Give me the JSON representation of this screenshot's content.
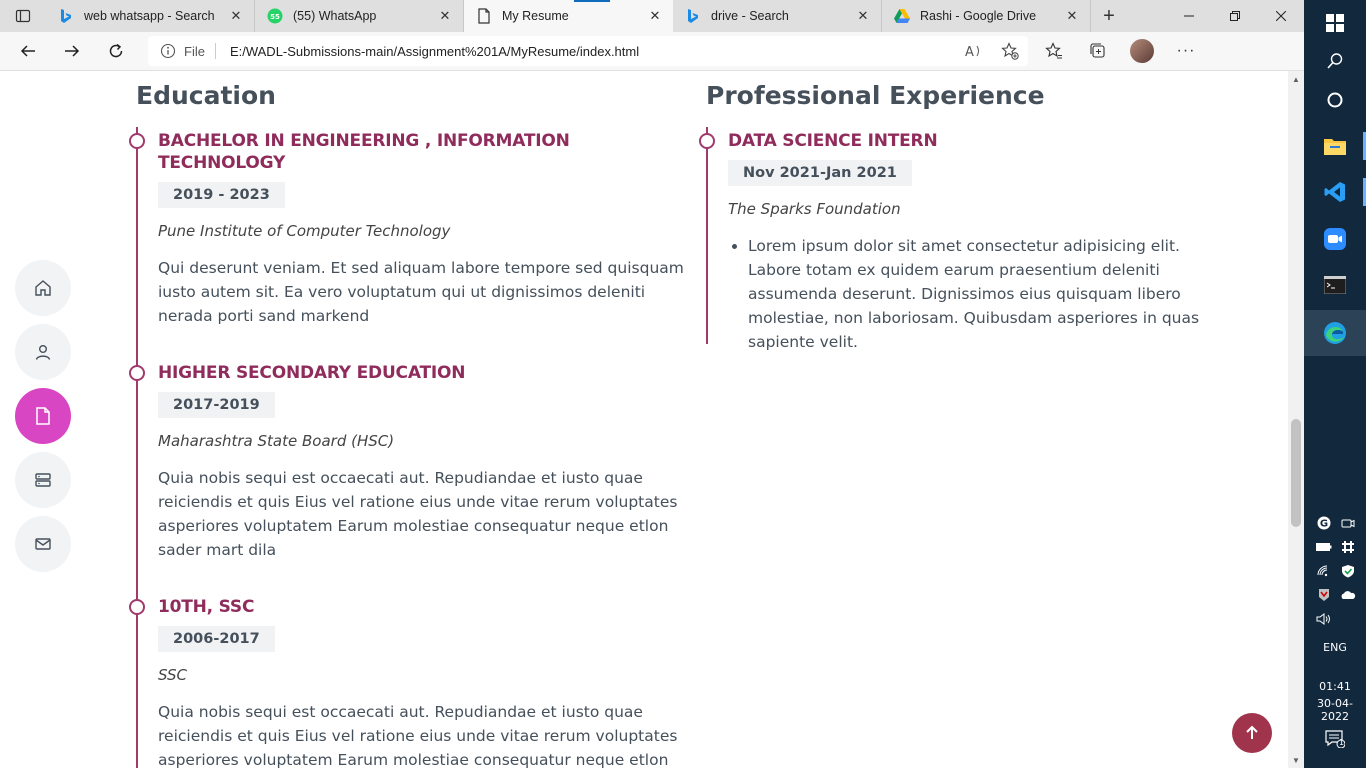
{
  "browser": {
    "tabs": [
      {
        "title": "web whatsapp - Search",
        "icon": "bing-icon",
        "active": false
      },
      {
        "title": "(55) WhatsApp",
        "icon": "whatsapp-icon",
        "active": false
      },
      {
        "title": "My Resume",
        "icon": "document-icon",
        "active": true
      },
      {
        "title": "drive - Search",
        "icon": "bing-icon",
        "active": false
      },
      {
        "title": "Rashi - Google Drive",
        "icon": "google-drive-icon",
        "active": false
      }
    ],
    "address": {
      "scheme_label": "File",
      "url": "E:/WADL-Submissions-main/Assignment%201A/MyResume/index.html"
    }
  },
  "resume": {
    "education": {
      "heading": "Education",
      "items": [
        {
          "title": "BACHELOR IN ENGINEERING , INFORMATION TECHNOLOGY",
          "period": "2019 - 2023",
          "org": "Pune Institute of Computer Technology",
          "description": "Qui deserunt veniam. Et sed aliquam labore tempore sed quisquam iusto autem sit. Ea vero voluptatum qui ut dignissimos deleniti nerada porti sand markend"
        },
        {
          "title": "HIGHER SECONDARY EDUCATION",
          "period": "2017-2019",
          "org": "Maharashtra State Board (HSC)",
          "description": "Quia nobis sequi est occaecati aut. Repudiandae et iusto quae reiciendis et quis Eius vel ratione eius unde vitae rerum voluptates asperiores voluptatem Earum molestiae consequatur neque etlon sader mart dila"
        },
        {
          "title": "10TH, SSC",
          "period": "2006-2017",
          "org": "SSC",
          "description": "Quia nobis sequi est occaecati aut. Repudiandae et iusto quae reiciendis et quis Eius vel ratione eius unde vitae rerum voluptates asperiores voluptatem Earum molestiae consequatur neque etlon sader mart dila"
        }
      ]
    },
    "experience": {
      "heading": "Professional Experience",
      "items": [
        {
          "title": "DATA SCIENCE INTERN",
          "period": "Nov 2021-Jan 2021",
          "org": "The Sparks Foundation",
          "bullets": [
            "Lorem ipsum dolor sit amet consectetur adipisicing elit. Labore totam ex quidem earum praesentium deleniti assumenda deserunt. Dignissimos eius quisquam libero molestiae, non laboriosam. Quibusdam asperiores in quas sapiente velit."
          ]
        }
      ]
    }
  },
  "sidenav": {
    "items": [
      "home-icon",
      "person-icon",
      "resume-icon",
      "services-icon",
      "mail-icon"
    ],
    "active": "resume-icon"
  },
  "colors": {
    "accent": "#8f2c5c",
    "nav_active": "#d946c4",
    "back_to_top": "#a1344d",
    "heading": "#45505b"
  },
  "taskbar": {
    "language": "ENG",
    "time": "01:41",
    "date": "30-04-2022",
    "notification_count": "1"
  }
}
